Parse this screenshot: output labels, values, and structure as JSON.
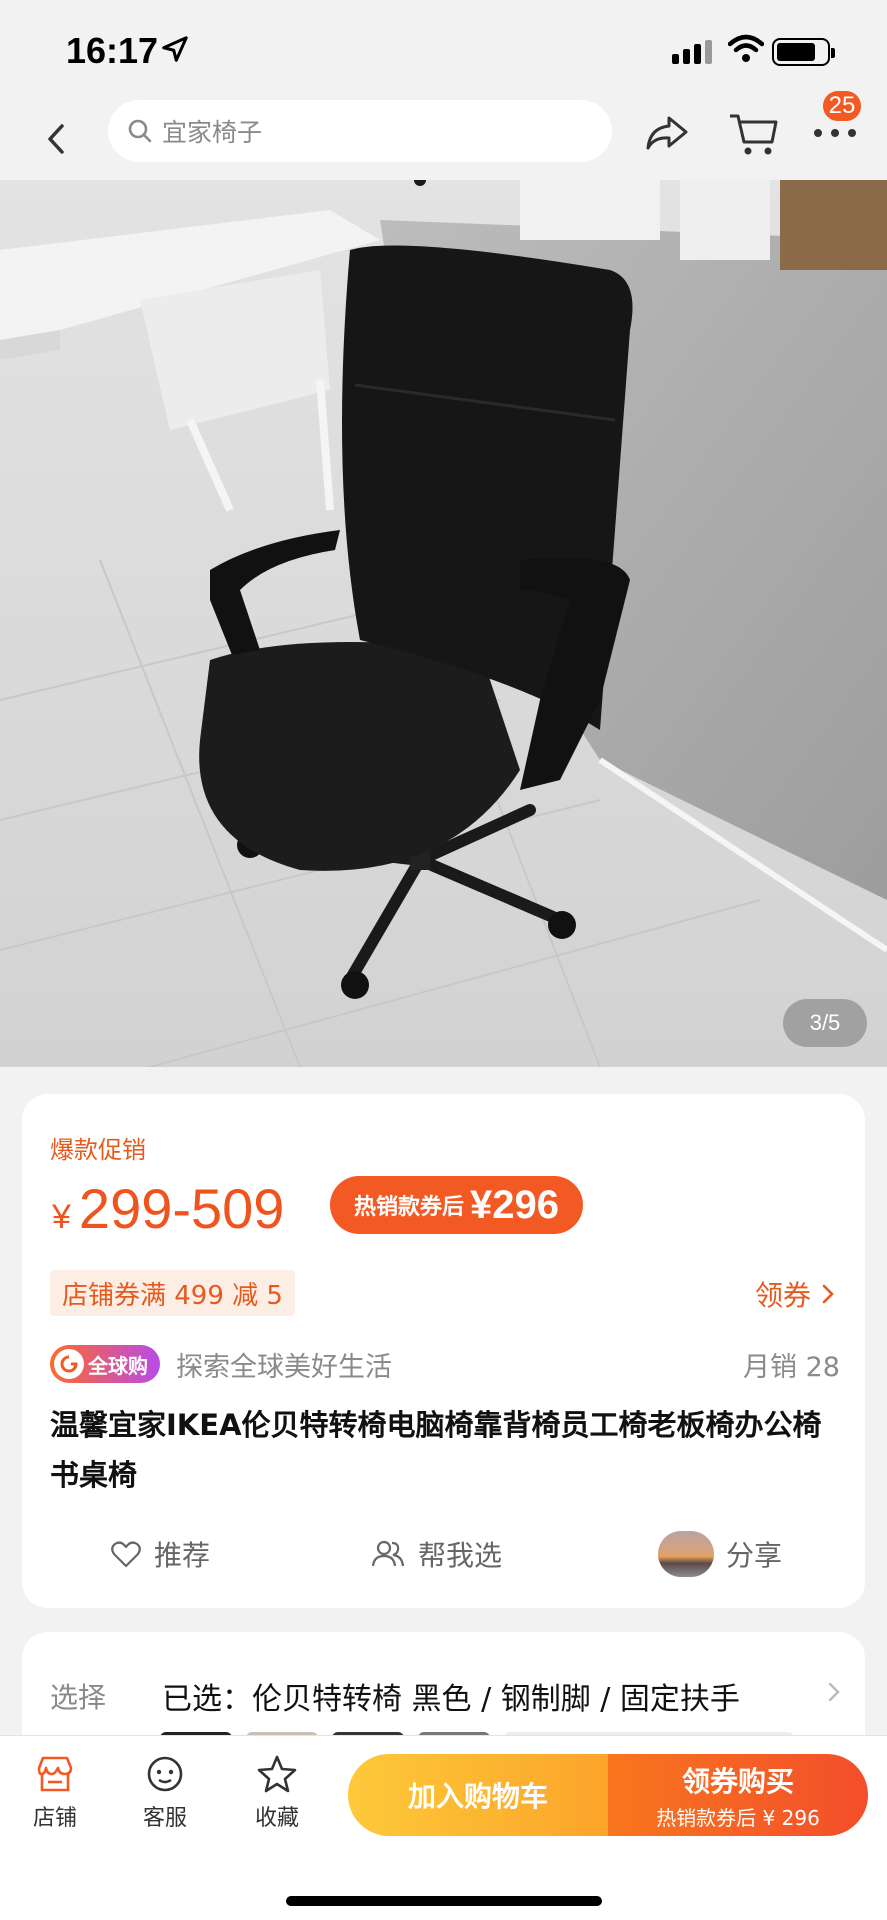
{
  "status_bar": {
    "time": "16:17"
  },
  "nav": {
    "search_placeholder": "宜家椅子",
    "badge_count": "25"
  },
  "gallery": {
    "counter": "3/5"
  },
  "product": {
    "promo_tag": "爆款促销",
    "currency": "¥",
    "price_range": "299-509",
    "coupon_label": "热销款券后",
    "coupon_price": "¥296",
    "store_coupon": "店铺券满 499 减 5",
    "get_coupon": "领券",
    "global_badge": "全球购",
    "global_slogan": "探索全球美好生活",
    "monthly_sales": "月销  28",
    "title": "温馨宜家IKEA伦贝特转椅电脑椅靠背椅员工椅老板椅办公椅书桌椅",
    "actions": {
      "recommend": "推荐",
      "help_choose": "帮我选",
      "share": "分享"
    }
  },
  "selection": {
    "label": "选择",
    "value": "已选：伦贝特转椅 黑色 / 钢制脚 / 固定扶手"
  },
  "bottom_bar": {
    "store": "店铺",
    "service": "客服",
    "favorite": "收藏",
    "add_to_cart": "加入购物车",
    "buy_title": "领券购买",
    "buy_sub": "热销款券后 ¥ 296"
  },
  "colors": {
    "accent": "#f35a23",
    "cart_btn": "#fca42a",
    "bg": "#f2f2f2"
  }
}
